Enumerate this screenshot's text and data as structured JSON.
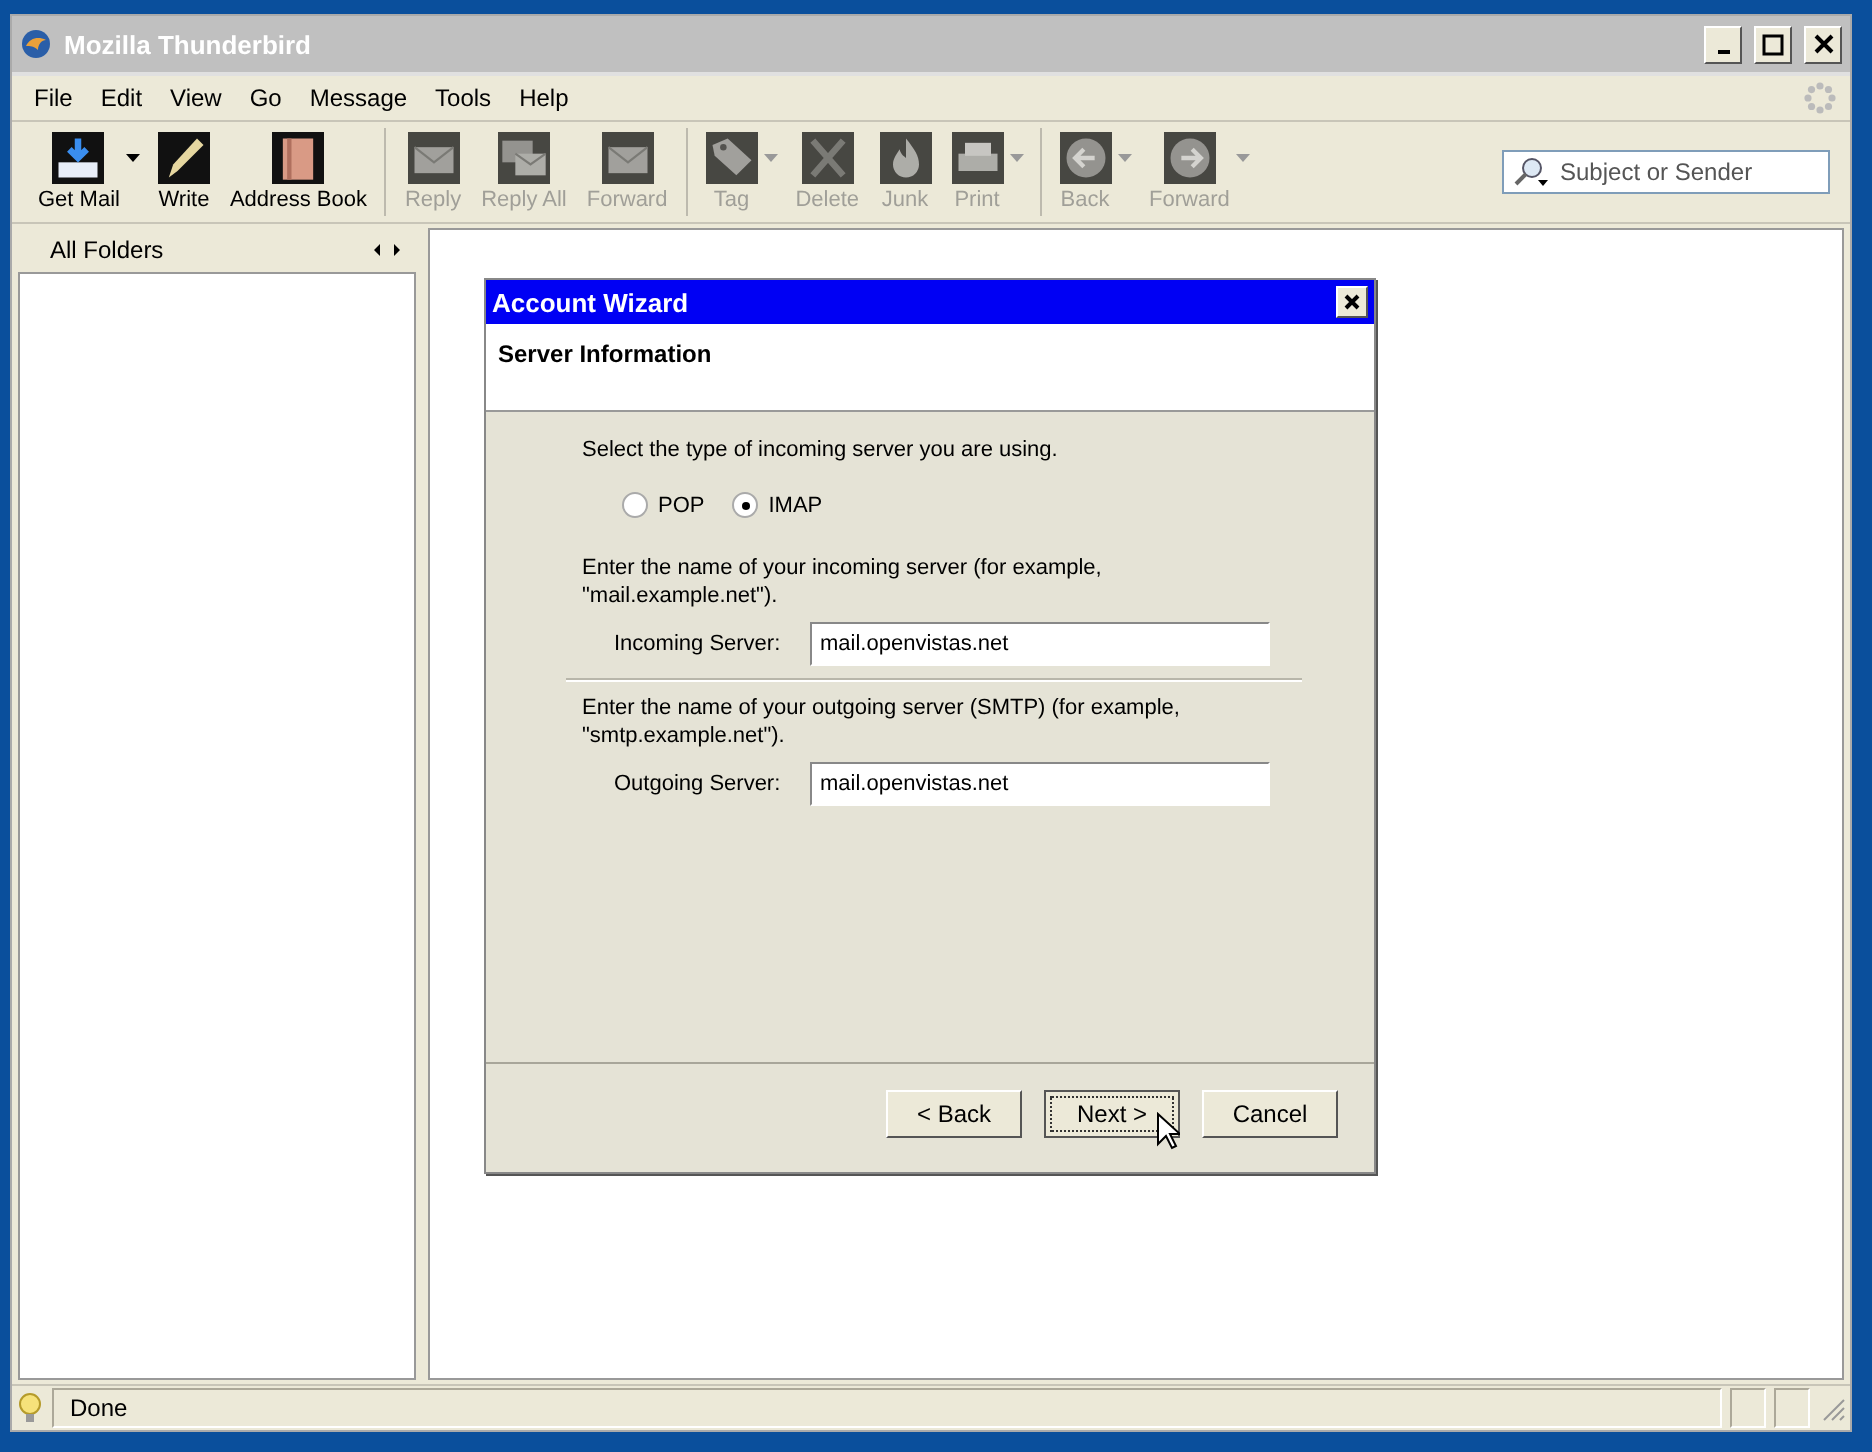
{
  "window": {
    "title": "Mozilla Thunderbird"
  },
  "menu": [
    "File",
    "Edit",
    "View",
    "Go",
    "Message",
    "Tools",
    "Help"
  ],
  "toolbar_groups": [
    [
      {
        "label": "Get Mail",
        "disabled": false,
        "dropdown": true
      },
      {
        "label": "Write",
        "disabled": false,
        "dropdown": false
      },
      {
        "label": "Address Book",
        "disabled": false,
        "dropdown": false
      }
    ],
    [
      {
        "label": "Reply",
        "disabled": true,
        "dropdown": false
      },
      {
        "label": "Reply All",
        "disabled": true,
        "dropdown": false
      },
      {
        "label": "Forward",
        "disabled": true,
        "dropdown": false
      }
    ],
    [
      {
        "label": "Tag",
        "disabled": true,
        "dropdown": true
      },
      {
        "label": "Delete",
        "disabled": true,
        "dropdown": false
      },
      {
        "label": "Junk",
        "disabled": true,
        "dropdown": false
      },
      {
        "label": "Print",
        "disabled": true,
        "dropdown": true
      }
    ],
    [
      {
        "label": "Back",
        "disabled": true,
        "dropdown": true
      },
      {
        "label": "Forward",
        "disabled": true,
        "dropdown": true
      }
    ]
  ],
  "search": {
    "placeholder": "Subject or Sender"
  },
  "folder_pane": {
    "header": "All Folders"
  },
  "dialog": {
    "title": "Account Wizard",
    "heading": "Server Information",
    "server_type_prompt": "Select the type of incoming server you are using.",
    "server_types": [
      {
        "label": "POP",
        "selected": false
      },
      {
        "label": "IMAP",
        "selected": true
      }
    ],
    "incoming": {
      "hint": "Enter the name of your incoming server (for example, \"mail.example.net\").",
      "label": "Incoming Server:",
      "value": "mail.openvistas.net"
    },
    "outgoing": {
      "hint": "Enter the name of your outgoing server (SMTP) (for example, \"smtp.example.net\").",
      "label": "Outgoing Server:",
      "value": "mail.openvistas.net"
    },
    "buttons": [
      {
        "label": "< Back",
        "focused": false
      },
      {
        "label": "Next >",
        "focused": true
      },
      {
        "label": "Cancel",
        "focused": false
      }
    ]
  },
  "status_bar": {
    "text": "Done"
  }
}
